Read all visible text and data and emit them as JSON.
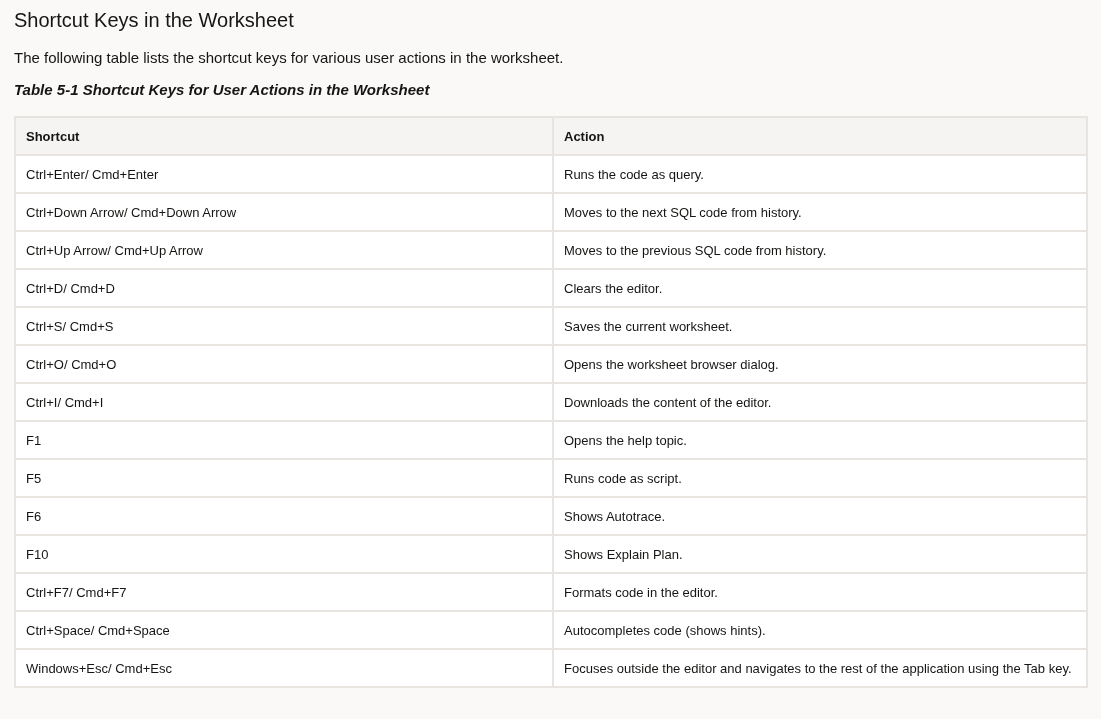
{
  "heading": "Shortcut Keys in the Worksheet",
  "intro": "The following table lists the shortcut keys for various user actions in the worksheet.",
  "table": {
    "caption": "Table 5-1 Shortcut Keys for User Actions in the Worksheet",
    "columns": [
      "Shortcut",
      "Action"
    ],
    "rows": [
      [
        "Ctrl+Enter/ Cmd+Enter",
        "Runs the code as query."
      ],
      [
        "Ctrl+Down Arrow/ Cmd+Down Arrow",
        "Moves to the next SQL code from history."
      ],
      [
        "Ctrl+Up Arrow/ Cmd+Up Arrow",
        "Moves to the previous SQL code from history."
      ],
      [
        "Ctrl+D/ Cmd+D",
        "Clears the editor."
      ],
      [
        "Ctrl+S/ Cmd+S",
        "Saves the current worksheet."
      ],
      [
        "Ctrl+O/ Cmd+O",
        "Opens the worksheet browser dialog."
      ],
      [
        "Ctrl+I/ Cmd+I",
        "Downloads the content of the editor."
      ],
      [
        "F1",
        "Opens the help topic."
      ],
      [
        "F5",
        "Runs code as script."
      ],
      [
        "F6",
        "Shows Autotrace."
      ],
      [
        "F10",
        "Shows Explain Plan."
      ],
      [
        "Ctrl+F7/ Cmd+F7",
        "Formats code in the editor."
      ],
      [
        "Ctrl+Space/ Cmd+Space",
        "Autocompletes code (shows hints)."
      ],
      [
        "Windows+Esc/ Cmd+Esc",
        "Focuses outside the editor and navigates to the rest of the application using the Tab key."
      ]
    ]
  }
}
